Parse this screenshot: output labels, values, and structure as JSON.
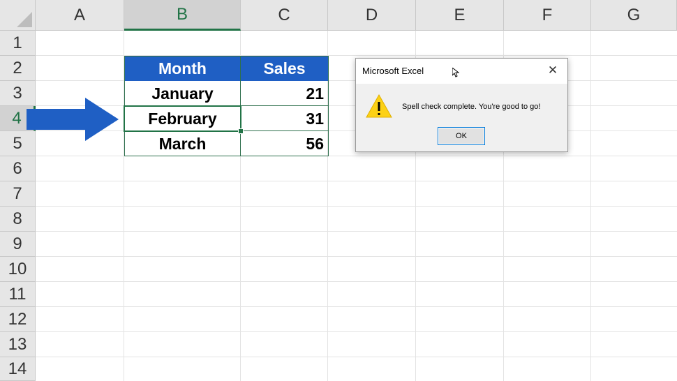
{
  "columns": [
    "A",
    "B",
    "C",
    "D",
    "E",
    "F",
    "G"
  ],
  "selected_column": "B",
  "rows": [
    "1",
    "2",
    "3",
    "4",
    "5",
    "6",
    "7",
    "8",
    "9",
    "10",
    "11",
    "12",
    "13",
    "14"
  ],
  "selected_row": "4",
  "table": {
    "headers": [
      "Month",
      "Sales"
    ],
    "rows": [
      {
        "month": "January",
        "sales": "21"
      },
      {
        "month": "February",
        "sales": "31"
      },
      {
        "month": "March",
        "sales": "56"
      }
    ],
    "header_color": "#1f5fc4"
  },
  "arrow": {
    "icon": "right-arrow-icon",
    "color": "#1f5fc4",
    "points_to_row": "4"
  },
  "dialog": {
    "title": "Microsoft Excel",
    "close_symbol": "✕",
    "icon": "warning-icon",
    "message": "Spell check complete. You're good to go!",
    "ok_label": "OK"
  }
}
